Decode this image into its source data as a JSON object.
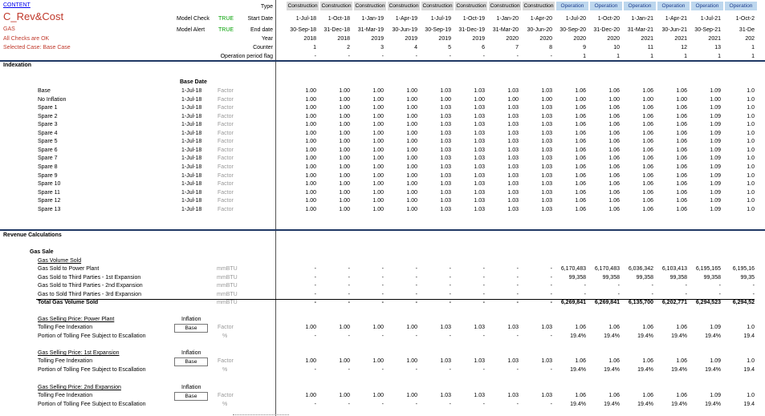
{
  "header": {
    "content_link": "CONTENT",
    "sheet_title": "C_Rev&Cost",
    "sheet_sub": "GAS",
    "checks_ok": "All Checks are OK",
    "selected_case": "Selected Case: Base Case",
    "model_check_label": "Model Check",
    "model_check_value": "TRUE",
    "model_alert_label": "Model Alert",
    "model_alert_value": "TRUE",
    "row_labels": [
      "Type",
      "Start Date",
      "End date",
      "Year",
      "Counter",
      "Operation period flag"
    ]
  },
  "columns": {
    "type": [
      "Construction",
      "Construction",
      "Construction",
      "Construction",
      "Construction",
      "Construction",
      "Construction",
      "Construction",
      "Operation",
      "Operation",
      "Operation",
      "Operation",
      "Operation",
      "Operation"
    ],
    "start": [
      "1-Jul-18",
      "1-Oct-18",
      "1-Jan-19",
      "1-Apr-19",
      "1-Jul-19",
      "1-Oct-19",
      "1-Jan-20",
      "1-Apr-20",
      "1-Jul-20",
      "1-Oct-20",
      "1-Jan-21",
      "1-Apr-21",
      "1-Jul-21",
      "1-Oct-2"
    ],
    "end": [
      "30-Sep-18",
      "31-Dec-18",
      "31-Mar-19",
      "30-Jun-19",
      "30-Sep-19",
      "31-Dec-19",
      "31-Mar-20",
      "30-Jun-20",
      "30-Sep-20",
      "31-Dec-20",
      "31-Mar-21",
      "30-Jun-21",
      "30-Sep-21",
      "31-De"
    ],
    "year": [
      "2018",
      "2018",
      "2019",
      "2019",
      "2019",
      "2019",
      "2020",
      "2020",
      "2020",
      "2020",
      "2021",
      "2021",
      "2021",
      "202"
    ],
    "counter": [
      "1",
      "2",
      "3",
      "4",
      "5",
      "6",
      "7",
      "8",
      "9",
      "10",
      "11",
      "12",
      "13",
      "1"
    ],
    "flag": [
      "-",
      "-",
      "-",
      "-",
      "-",
      "-",
      "-",
      "-",
      "1",
      "1",
      "1",
      "1",
      "1",
      "1"
    ]
  },
  "indexation": {
    "title": "Indexation",
    "base_date_header": "Base Date",
    "rows": [
      {
        "label": "Base",
        "date": "1-Jul-18",
        "unit": "Factor",
        "vals": [
          "1.00",
          "1.00",
          "1.00",
          "1.00",
          "1.03",
          "1.03",
          "1.03",
          "1.03",
          "1.06",
          "1.06",
          "1.06",
          "1.06",
          "1.09",
          "1.0"
        ]
      },
      {
        "label": "No Inflation",
        "date": "1-Jul-18",
        "unit": "Factor",
        "vals": [
          "1.00",
          "1.00",
          "1.00",
          "1.00",
          "1.00",
          "1.00",
          "1.00",
          "1.00",
          "1.00",
          "1.00",
          "1.00",
          "1.00",
          "1.00",
          "1.0"
        ]
      },
      {
        "label": "Spare 1",
        "date": "1-Jul-18",
        "unit": "Factor",
        "vals": [
          "1.00",
          "1.00",
          "1.00",
          "1.00",
          "1.03",
          "1.03",
          "1.03",
          "1.03",
          "1.06",
          "1.06",
          "1.06",
          "1.06",
          "1.09",
          "1.0"
        ]
      },
      {
        "label": "Spare 2",
        "date": "1-Jul-18",
        "unit": "Factor",
        "vals": [
          "1.00",
          "1.00",
          "1.00",
          "1.00",
          "1.03",
          "1.03",
          "1.03",
          "1.03",
          "1.06",
          "1.06",
          "1.06",
          "1.06",
          "1.09",
          "1.0"
        ]
      },
      {
        "label": "Spare 3",
        "date": "1-Jul-18",
        "unit": "Factor",
        "vals": [
          "1.00",
          "1.00",
          "1.00",
          "1.00",
          "1.03",
          "1.03",
          "1.03",
          "1.03",
          "1.06",
          "1.06",
          "1.06",
          "1.06",
          "1.09",
          "1.0"
        ]
      },
      {
        "label": "Spare 4",
        "date": "1-Jul-18",
        "unit": "Factor",
        "vals": [
          "1.00",
          "1.00",
          "1.00",
          "1.00",
          "1.03",
          "1.03",
          "1.03",
          "1.03",
          "1.06",
          "1.06",
          "1.06",
          "1.06",
          "1.09",
          "1.0"
        ]
      },
      {
        "label": "Spare 5",
        "date": "1-Jul-18",
        "unit": "Factor",
        "vals": [
          "1.00",
          "1.00",
          "1.00",
          "1.00",
          "1.03",
          "1.03",
          "1.03",
          "1.03",
          "1.06",
          "1.06",
          "1.06",
          "1.06",
          "1.09",
          "1.0"
        ]
      },
      {
        "label": "Spare 6",
        "date": "1-Jul-18",
        "unit": "Factor",
        "vals": [
          "1.00",
          "1.00",
          "1.00",
          "1.00",
          "1.03",
          "1.03",
          "1.03",
          "1.03",
          "1.06",
          "1.06",
          "1.06",
          "1.06",
          "1.09",
          "1.0"
        ]
      },
      {
        "label": "Spare 7",
        "date": "1-Jul-18",
        "unit": "Factor",
        "vals": [
          "1.00",
          "1.00",
          "1.00",
          "1.00",
          "1.03",
          "1.03",
          "1.03",
          "1.03",
          "1.06",
          "1.06",
          "1.06",
          "1.06",
          "1.09",
          "1.0"
        ]
      },
      {
        "label": "Spare 8",
        "date": "1-Jul-18",
        "unit": "Factor",
        "vals": [
          "1.00",
          "1.00",
          "1.00",
          "1.00",
          "1.03",
          "1.03",
          "1.03",
          "1.03",
          "1.06",
          "1.06",
          "1.06",
          "1.06",
          "1.09",
          "1.0"
        ]
      },
      {
        "label": "Spare 9",
        "date": "1-Jul-18",
        "unit": "Factor",
        "vals": [
          "1.00",
          "1.00",
          "1.00",
          "1.00",
          "1.03",
          "1.03",
          "1.03",
          "1.03",
          "1.06",
          "1.06",
          "1.06",
          "1.06",
          "1.09",
          "1.0"
        ]
      },
      {
        "label": "Spare 10",
        "date": "1-Jul-18",
        "unit": "Factor",
        "vals": [
          "1.00",
          "1.00",
          "1.00",
          "1.00",
          "1.03",
          "1.03",
          "1.03",
          "1.03",
          "1.06",
          "1.06",
          "1.06",
          "1.06",
          "1.09",
          "1.0"
        ]
      },
      {
        "label": "Spare 11",
        "date": "1-Jul-18",
        "unit": "Factor",
        "vals": [
          "1.00",
          "1.00",
          "1.00",
          "1.00",
          "1.03",
          "1.03",
          "1.03",
          "1.03",
          "1.06",
          "1.06",
          "1.06",
          "1.06",
          "1.09",
          "1.0"
        ]
      },
      {
        "label": "Spare 12",
        "date": "1-Jul-18",
        "unit": "Factor",
        "vals": [
          "1.00",
          "1.00",
          "1.00",
          "1.00",
          "1.03",
          "1.03",
          "1.03",
          "1.03",
          "1.06",
          "1.06",
          "1.06",
          "1.06",
          "1.09",
          "1.0"
        ]
      },
      {
        "label": "Spare 13",
        "date": "1-Jul-18",
        "unit": "Factor",
        "vals": [
          "1.00",
          "1.00",
          "1.00",
          "1.00",
          "1.03",
          "1.03",
          "1.03",
          "1.03",
          "1.06",
          "1.06",
          "1.06",
          "1.06",
          "1.09",
          "1.0"
        ]
      }
    ]
  },
  "revenue": {
    "title": "Revenue Calculations",
    "gas_sale": "Gas Sale",
    "volume_title": "Gas Volume Sold",
    "volume_rows": [
      {
        "label": "Gas Sold to Power Plant",
        "unit": "mmBTU",
        "bold": false,
        "vals": [
          "-",
          "-",
          "-",
          "-",
          "-",
          "-",
          "-",
          "-",
          "6,170,483",
          "6,170,483",
          "6,036,342",
          "6,103,413",
          "6,195,165",
          "6,195,16"
        ]
      },
      {
        "label": "Gas Sold to Third Parties - 1st Expansion",
        "unit": "mmBTU",
        "bold": false,
        "vals": [
          "-",
          "-",
          "-",
          "-",
          "-",
          "-",
          "-",
          "-",
          "99,358",
          "99,358",
          "99,358",
          "99,358",
          "99,358",
          "99,35"
        ]
      },
      {
        "label": "Gas Sold to Third Parties - 2nd Expansion",
        "unit": "mmBTU",
        "bold": false,
        "vals": [
          "-",
          "-",
          "-",
          "-",
          "-",
          "-",
          "-",
          "-",
          "-",
          "-",
          "-",
          "-",
          "-",
          "-"
        ]
      },
      {
        "label": "Gas to Sold Third Parties - 3rd Expansion",
        "unit": "mmBTU",
        "bold": false,
        "vals": [
          "-",
          "-",
          "-",
          "-",
          "-",
          "-",
          "-",
          "-",
          "-",
          "-",
          "-",
          "-",
          "-",
          "-"
        ]
      },
      {
        "label": "Total Gas Volume Sold",
        "unit": "mmBTU",
        "bold": true,
        "vals": [
          "-",
          "-",
          "-",
          "-",
          "-",
          "-",
          "-",
          "-",
          "6,269,841",
          "6,269,841",
          "6,135,700",
          "6,202,771",
          "6,294,523",
          "6,294,52"
        ]
      }
    ],
    "price_blocks": [
      {
        "title": "Gas Selling Price: Power Plant",
        "inflation_label": "Inflation",
        "inflation_value": "Base",
        "rows": [
          {
            "label": "Tolling Fee Indexation",
            "unit": "Factor",
            "vals": [
              "1.00",
              "1.00",
              "1.00",
              "1.00",
              "1.03",
              "1.03",
              "1.03",
              "1.03",
              "1.06",
              "1.06",
              "1.06",
              "1.06",
              "1.09",
              "1.0"
            ]
          },
          {
            "label": "Portion of Tolling Fee Subject to Escallation",
            "unit": "%",
            "vals": [
              "-",
              "-",
              "-",
              "-",
              "-",
              "-",
              "-",
              "-",
              "19.4%",
              "19.4%",
              "19.4%",
              "19.4%",
              "19.4%",
              "19.4"
            ]
          }
        ]
      },
      {
        "title": "Gas Selling Price: 1st Expansion",
        "inflation_label": "Inflation",
        "inflation_value": "Base",
        "rows": [
          {
            "label": "Tolling Fee Indexation",
            "unit": "Factor",
            "vals": [
              "1.00",
              "1.00",
              "1.00",
              "1.00",
              "1.03",
              "1.03",
              "1.03",
              "1.03",
              "1.06",
              "1.06",
              "1.06",
              "1.06",
              "1.09",
              "1.0"
            ]
          },
          {
            "label": "Portion of Tolling Fee Subject to Escallation",
            "unit": "%",
            "vals": [
              "-",
              "-",
              "-",
              "-",
              "-",
              "-",
              "-",
              "-",
              "19.4%",
              "19.4%",
              "19.4%",
              "19.4%",
              "19.4%",
              "19.4"
            ]
          }
        ]
      },
      {
        "title": "Gas Selling Price: 2nd Expansion",
        "inflation_label": "Inflation",
        "inflation_value": "Base",
        "rows": [
          {
            "label": "Tolling Fee Indexation",
            "unit": "Factor",
            "vals": [
              "1.00",
              "1.00",
              "1.00",
              "1.00",
              "1.03",
              "1.03",
              "1.03",
              "1.03",
              "1.06",
              "1.06",
              "1.06",
              "1.06",
              "1.09",
              "1.0"
            ]
          },
          {
            "label": "Portion of Tolling Fee Subject to Escallation",
            "unit": "%",
            "vals": [
              "-",
              "-",
              "-",
              "-",
              "-",
              "-",
              "-",
              "-",
              "19.4%",
              "19.4%",
              "19.4%",
              "19.4%",
              "19.4%",
              "19.4"
            ]
          }
        ]
      }
    ]
  }
}
